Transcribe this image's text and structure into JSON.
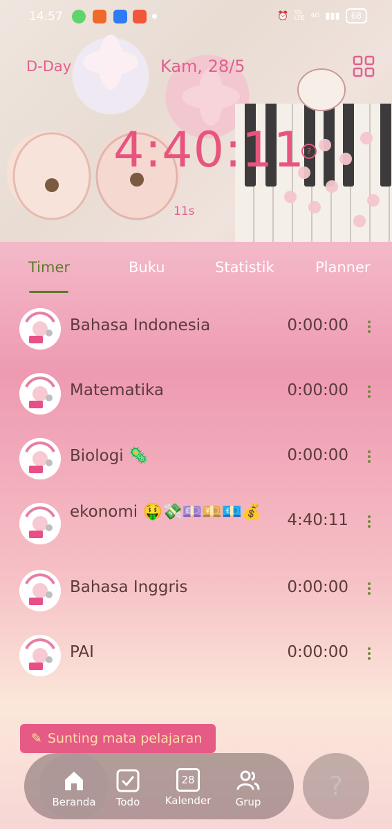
{
  "status_bar": {
    "time": "14.57",
    "signal_label": "4G",
    "volte": "Vo LTE",
    "battery": "68"
  },
  "header": {
    "dday_label": "D-Day",
    "date": "Kam, 28/5",
    "timer": "4:40:11",
    "seconds": "11s",
    "help_glyph": "?"
  },
  "tabs": [
    {
      "label": "Timer",
      "active": true
    },
    {
      "label": "Buku",
      "active": false
    },
    {
      "label": "Statistik",
      "active": false
    },
    {
      "label": "Planner",
      "active": false
    }
  ],
  "subjects": [
    {
      "name": "Bahasa Indonesia",
      "time": "0:00:00"
    },
    {
      "name": "Matematika",
      "time": "0:00:00"
    },
    {
      "name": "Biologi 🦠",
      "time": "0:00:00"
    },
    {
      "name": "ekonomi 🤑💸💷💴💶💰",
      "time": "4:40:11"
    },
    {
      "name": "Bahasa Inggris",
      "time": "0:00:00"
    },
    {
      "name": "PAI",
      "time": "0:00:00"
    }
  ],
  "edit_button": {
    "label": "Sunting mata pelajaran",
    "icon": "pencil-icon"
  },
  "bottom_nav": [
    {
      "label": "Beranda",
      "icon": "home-icon",
      "active": true
    },
    {
      "label": "Todo",
      "icon": "checkbox-icon",
      "active": false
    },
    {
      "label": "Kalender",
      "icon": "calendar-icon",
      "day": "28",
      "active": false
    },
    {
      "label": "Grup",
      "icon": "group-icon",
      "active": false
    }
  ],
  "help_button": {
    "glyph": "?"
  },
  "colors": {
    "accent": "#e7557f",
    "tab_active": "#5c7a2a",
    "text": "#5b3a3a"
  }
}
